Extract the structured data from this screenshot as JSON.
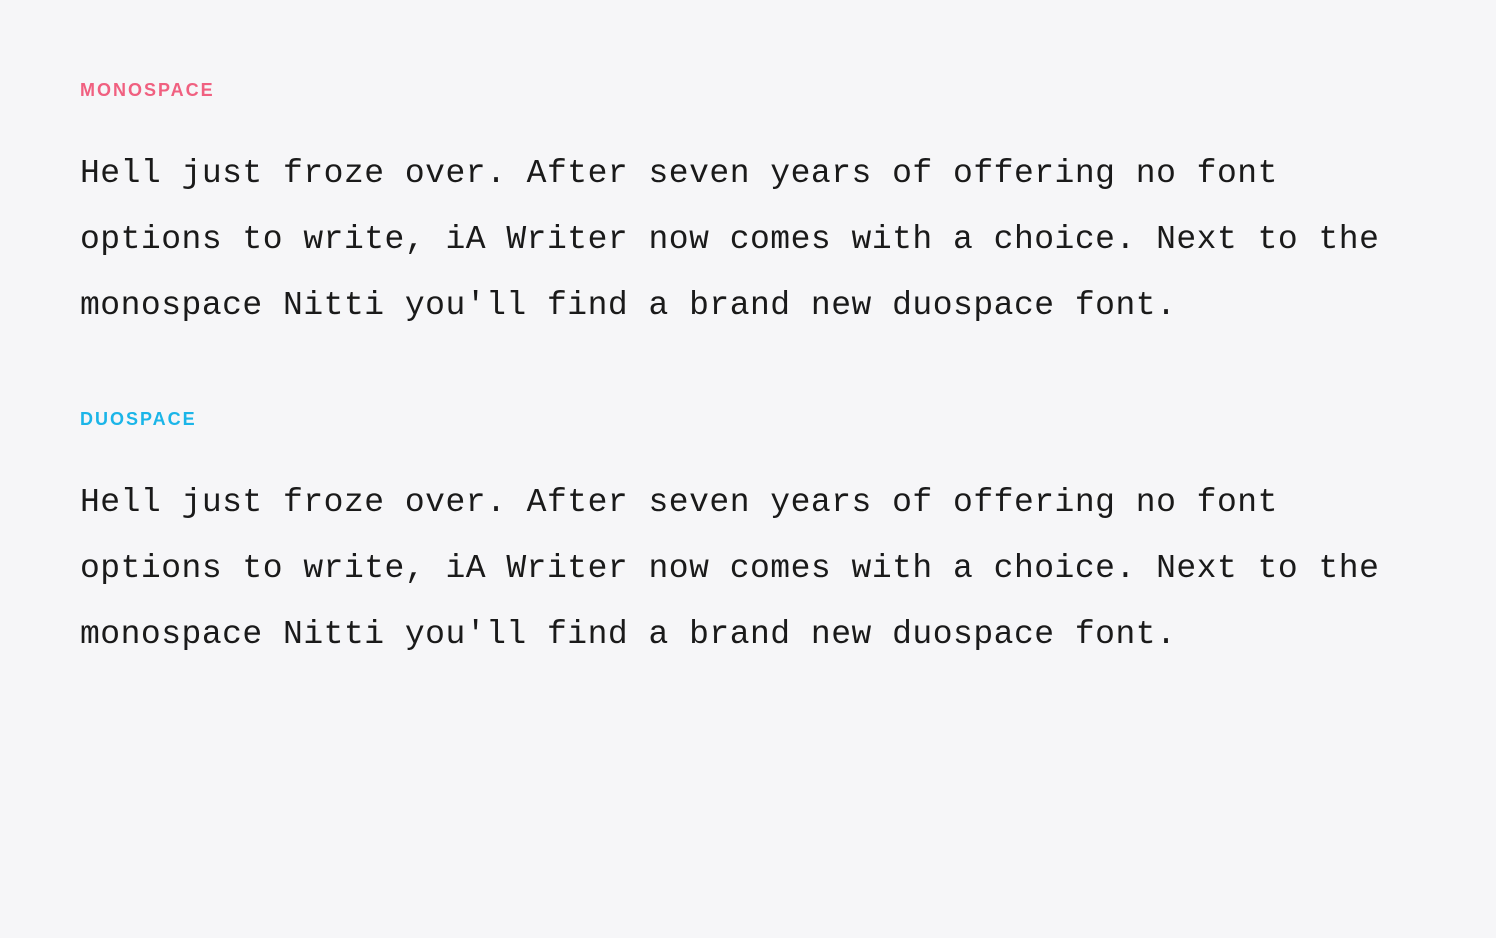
{
  "sections": {
    "monospace": {
      "label": "MONOSPACE",
      "body": "Hell just froze over. After seven years of offering no font options to write, iA Writer now comes with a choice. Next to the monospace Nitti you'll find a brand new duospace font."
    },
    "duospace": {
      "label": "DUOSPACE",
      "body": "Hell just froze over. After seven years of offering no font options to write, iA Writer now comes with a choice. Next to the monospace Nitti you'll find a brand new duospace font."
    }
  },
  "colors": {
    "background": "#f6f6f8",
    "text": "#1a1a1a",
    "monospace_label": "#f06080",
    "duospace_label": "#1bb5e8"
  }
}
